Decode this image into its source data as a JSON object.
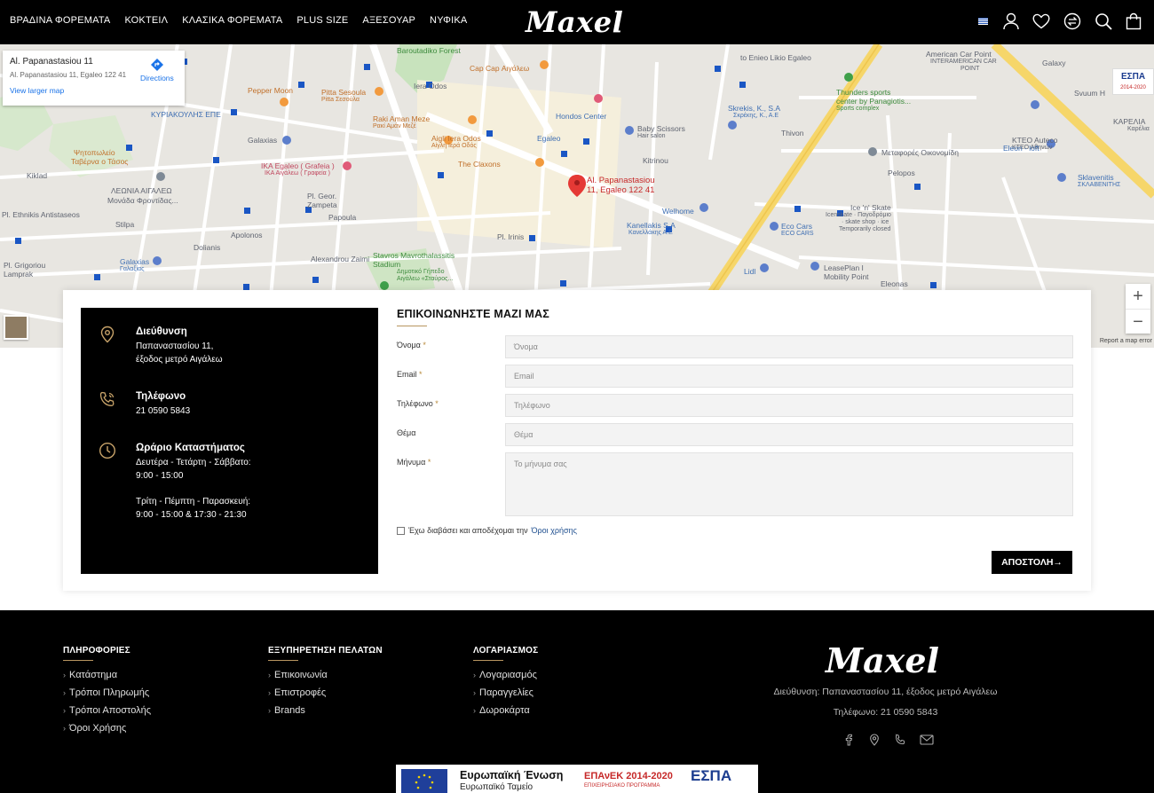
{
  "header": {
    "nav": [
      "ΒΡΑΔΙΝΑ ΦΟΡΕΜΑΤΑ",
      "ΚΟΚΤΕΙΛ",
      "ΚΛΑΣΙΚΑ ΦΟΡΕΜΑΤΑ",
      "PLUS SIZE",
      "ΑΞΕΣΟΥΑΡ",
      "ΝΥΦΙΚΑ"
    ],
    "logo": "Maxel",
    "icons": [
      "flag-icon",
      "user-icon",
      "heart-icon",
      "compare-icon",
      "search-icon",
      "bag-icon"
    ]
  },
  "map": {
    "info_title": "Al. Papanastasiou 11",
    "info_address": "Al. Papanastasiou 11, Egaleo 122 41",
    "view_larger": "View larger map",
    "directions": "Directions",
    "pin_label_1": "Al. Papanastasiou",
    "pin_label_2": "11, Egaleo 122 41",
    "zoom_in": "+",
    "zoom_out": "−",
    "report": "Report a map error",
    "espa_badge": "ΕΣΠΑ",
    "espa_badge_years": "2014-2020",
    "labels": {
      "l1": "Baroutadiko Forest",
      "l2": "Cap Cap Αιγάλεω",
      "l3": "Pepper Moon",
      "l4": "Pitta Sesoula",
      "l5": "Pitta Σεσούλα",
      "l6": "ΚΥΡΙΑΚΟΥΛΗΣ ΕΠΕ",
      "l7": "Raki Aman Meze",
      "l8": "Ρακί Αμάν Μεζέ",
      "l9": "Hondos Center",
      "l10": "Baby Scissors",
      "l11": "Hair salon",
      "l12": "Aigli Iera Odos",
      "l13": "Αίγλη Ιερά Οδός",
      "l14": "Galaxias",
      "l15": "Ψητοπωλείο",
      "l16": "Ταβέρνα ο Τάσος",
      "l17": "ΙΚΑ Egaleo ( Grafeia )",
      "l18": "ΙΚΑ Αιγάλεω ( Γραφεία )",
      "l19": "The Claxons",
      "l20": "ΛΕΩΝΙΑ ΑΙΓΑΛΕΩ",
      "l21": "Μονάδα Φροντίδας...",
      "l22": "Pl. Geor.",
      "l23": "Zampeta",
      "l24": "Welhome",
      "l25": "Kanellakis S.A",
      "l26": "Κανελλάκης Α.Ε",
      "l27": "Stavros Mavrothalassitis",
      "l28": "Stadium",
      "l29": "Δημοτικό Γήπεδο",
      "l30": "Αιγάλεω «Σταύρος...",
      "l31": "Pl. Irinis",
      "l32": "Skrekis, K., S.A",
      "l33": "Σκρέκης, Κ., Α.Ε",
      "l34": "Thunders sports",
      "l35": "center by Panagiotis...",
      "l36": "Sports complex",
      "l37": "Μεταφορές Οικονομίδη",
      "l38": "Ice 'n' Skate",
      "l39": "Icenskate · Παγοδρόμιο",
      "l40": "· skate shop · ice",
      "l41": "Temporarily closed",
      "l42": "Eco Cars",
      "l43": "ECO CARS",
      "l44": "LeasePlan I",
      "l45": "Mobility Point",
      "l46": "Lidl",
      "l47": "Eleonas",
      "l48": "KTEO Auteco",
      "l49": "ΚΤΕΟ Αθηνών",
      "l50": "Eleon - loft",
      "l51": "Sklavenitis",
      "l52": "ΣΚΛΑΒΕΝΙΤΗΣ",
      "l53": "Galaxy",
      "l54": "American Car Point",
      "l55": "INTERAMERICAN CAR",
      "l56": "POINT",
      "l57": "Svuum H",
      "l58": "ΚΑΡΕΛΙΑ",
      "l59": "Καρέλια",
      "l60": "Pl. Grigoriou",
      "l61": "Lamprak",
      "l62": "Galaxias",
      "l63": "Γαλαξίας",
      "l64": "Alexandrou Zaimi",
      "l65": "Pl. Ethnikis Antistaseos",
      "l66": "to Enieo Likio Egaleo",
      "l67": "Egaleo",
      "l68": "Kiklad",
      "l69": "Stilpa",
      "l70": "Dolianis",
      "l71": "Iera Odos",
      "l72": "Pelopos",
      "l73": "Thivon",
      "l74": "Papoula",
      "l75": "Apolonos",
      "l76": "Kitrinou"
    }
  },
  "contact": {
    "address_title": "Διεύθυνση",
    "address_line1": "Παπαναστασίου 11,",
    "address_line2": "έξοδος μετρό Αιγάλεω",
    "phone_title": "Τηλέφωνο",
    "phone_value": "21 0590 5843",
    "hours_title": "Ωράριο Καταστήματος",
    "hours_line1": "Δευτέρα - Τετάρτη - Σάββατο:",
    "hours_line2": "9:00 - 15:00",
    "hours_line3": "Τρίτη - Πέμπτη - Παρασκευή:",
    "hours_line4": "9:00 - 15:00 & 17:30 - 21:30"
  },
  "form": {
    "title": "ΕΠΙΚΟΙΝΩΝΗΣΤΕ ΜΑΖΙ ΜΑΣ",
    "fields": [
      {
        "label": "Όνομα",
        "required": "*",
        "placeholder": "Όνομα"
      },
      {
        "label": "Email",
        "required": "*",
        "placeholder": "Email"
      },
      {
        "label": "Τηλέφωνο",
        "required": "*",
        "placeholder": "Τηλέφωνο"
      },
      {
        "label": "Θέμα",
        "required": "",
        "placeholder": "Θέμα"
      },
      {
        "label": "Μήνυμα",
        "required": "*",
        "placeholder": "Το μήνυμα σας"
      }
    ],
    "terms_text": "Έχω διαβάσει και αποδέχομαι την",
    "terms_link": "Όροι χρήσης",
    "submit": "ΑΠΟΣΤΟΛΗ"
  },
  "footer": {
    "col1": {
      "title": "ΠΛΗΡΟΦΟΡΙΕΣ",
      "items": [
        "Κατάστημα",
        "Τρόποι Πληρωμής",
        "Τρόποι Αποστολής",
        "Όροι Χρήσης"
      ]
    },
    "col2": {
      "title": "ΕΞΥΠΗΡΕΤΗΣΗ ΠΕΛΑΤΩΝ",
      "items": [
        "Επικοινωνία",
        "Επιστροφές",
        "Brands"
      ]
    },
    "col3": {
      "title": "ΛΟΓΑΡΙΑΣΜΟΣ",
      "items": [
        "Λογαριασμός",
        "Παραγγελίες",
        "Δωροκάρτα"
      ]
    },
    "logo": "Maxel",
    "address": "Διεύθυνση: Παπαναστασίου 11, έξοδος μετρό Αιγάλεω",
    "phone": "Τηλέφωνο: 21 0590 5843",
    "social": [
      "facebook-icon",
      "location-icon",
      "phone-icon",
      "mail-icon"
    ],
    "eu_title": "Ευρωπαϊκή Ένωση",
    "eu_sub": "Ευρωπαϊκό Ταμείο",
    "epanek": "ΕΠΑνΕΚ 2014-2020",
    "epanek_sub": "ΕΠΙΧΕΙΡΗΣΙΑΚΟ ΠΡΟΓΡΑΜΜΑ",
    "espa": "ΕΣΠΑ"
  }
}
